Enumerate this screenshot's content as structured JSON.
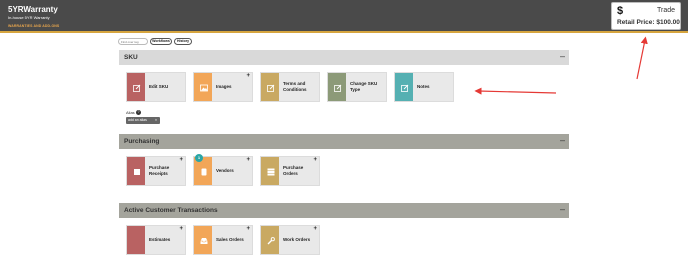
{
  "header": {
    "title": "5YRWarranty",
    "subtitle": "In-house 5YR Warranty",
    "link": "WARRANTIES AND ADD-ONS"
  },
  "price_card": {
    "currency_symbol": "$",
    "mode": "Trade",
    "retail": "Retail Price: $100.00"
  },
  "toolbar": {
    "search_placeholder": "Find over tag",
    "workflows": "Workflows",
    "history": "History"
  },
  "sections": [
    {
      "title": "SKU",
      "collapse": "–",
      "tiles": [
        {
          "label": "Edit SKU",
          "icon": "edit-icon",
          "color": "#b96262",
          "plus": ""
        },
        {
          "label": "Images",
          "icon": "image-icon",
          "color": "#f2a658",
          "plus": "+"
        },
        {
          "label": "Terms and Conditions",
          "icon": "edit-icon",
          "color": "#c9a962",
          "plus": ""
        },
        {
          "label": "Change SKU Type",
          "icon": "edit-icon",
          "color": "#8c9a78",
          "plus": ""
        },
        {
          "label": "Notes",
          "icon": "edit-icon",
          "color": "#55b0b2",
          "plus": ""
        }
      ]
    },
    {
      "title": "Purchasing",
      "collapse": "–",
      "tiles": [
        {
          "label": "Purchase Receipts",
          "icon": "box-icon",
          "color": "#b96262",
          "plus": "+"
        },
        {
          "label": "Vendors",
          "icon": "vendor-icon",
          "color": "#f2a658",
          "plus": "+",
          "badge": "1"
        },
        {
          "label": "Purchase Orders",
          "icon": "list-icon",
          "color": "#c9a962",
          "plus": "+"
        }
      ]
    },
    {
      "title": "Active Customer Transactions",
      "collapse": "–",
      "tiles": [
        {
          "label": "Estimates",
          "icon": "estimate-icon",
          "color": "#b96262",
          "plus": "+"
        },
        {
          "label": "Sales Orders",
          "icon": "inbox-icon",
          "color": "#f2a658",
          "plus": "+"
        },
        {
          "label": "Work Orders",
          "icon": "wrench-icon",
          "color": "#c9a962",
          "plus": "+"
        }
      ]
    }
  ],
  "alias": {
    "label": "Alias",
    "help": "?",
    "chip": "add an alias",
    "chip_close": "×"
  },
  "annotation_color": "#e53935"
}
